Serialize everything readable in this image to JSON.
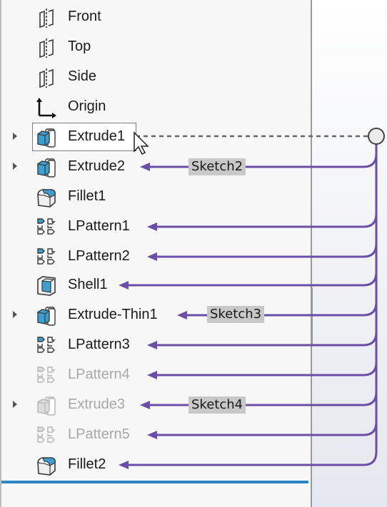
{
  "tree": {
    "items": [
      {
        "label": "Front",
        "icon": "plane-icon",
        "expandable": false,
        "state": "normal"
      },
      {
        "label": "Top",
        "icon": "plane-icon",
        "expandable": false,
        "state": "normal"
      },
      {
        "label": "Side",
        "icon": "plane-icon",
        "expandable": false,
        "state": "normal"
      },
      {
        "label": "Origin",
        "icon": "origin-icon",
        "expandable": false,
        "state": "normal"
      },
      {
        "label": "Extrude1",
        "icon": "extrude-icon",
        "expandable": true,
        "state": "selected"
      },
      {
        "label": "Extrude2",
        "icon": "extrude-icon",
        "expandable": true,
        "state": "normal"
      },
      {
        "label": "Fillet1",
        "icon": "fillet-icon",
        "expandable": false,
        "state": "normal"
      },
      {
        "label": "LPattern1",
        "icon": "linear-pattern-icon",
        "expandable": false,
        "state": "normal"
      },
      {
        "label": "LPattern2",
        "icon": "linear-pattern-icon",
        "expandable": false,
        "state": "normal"
      },
      {
        "label": "Shell1",
        "icon": "shell-icon",
        "expandable": false,
        "state": "normal"
      },
      {
        "label": "Extrude-Thin1",
        "icon": "extrude-icon",
        "expandable": true,
        "state": "normal"
      },
      {
        "label": "LPattern3",
        "icon": "linear-pattern-icon",
        "expandable": false,
        "state": "normal"
      },
      {
        "label": "LPattern4",
        "icon": "linear-pattern-icon",
        "expandable": false,
        "state": "suppressed"
      },
      {
        "label": "Extrude3",
        "icon": "extrude-icon",
        "expandable": true,
        "state": "suppressed"
      },
      {
        "label": "LPattern5",
        "icon": "linear-pattern-icon",
        "expandable": false,
        "state": "suppressed"
      },
      {
        "label": "Fillet2",
        "icon": "fillet-icon",
        "expandable": false,
        "state": "normal"
      }
    ]
  },
  "dependencies": {
    "parent": "Extrude1",
    "children": [
      "Extrude2",
      "LPattern1",
      "LPattern2",
      "Shell1",
      "Extrude-Thin1",
      "LPattern3",
      "LPattern4",
      "Extrude3",
      "LPattern5",
      "Fillet2"
    ],
    "labels": [
      {
        "child": "Extrude2",
        "text": "Sketch2"
      },
      {
        "child": "Extrude-Thin1",
        "text": "Sketch3"
      },
      {
        "child": "Extrude3",
        "text": "Sketch4"
      }
    ]
  },
  "colors": {
    "arrow": "#6a4fa6",
    "selection_border": "#7a7a7a",
    "rollback_bar": "#2a87c8",
    "icon_blue": "#3b9fcf"
  }
}
